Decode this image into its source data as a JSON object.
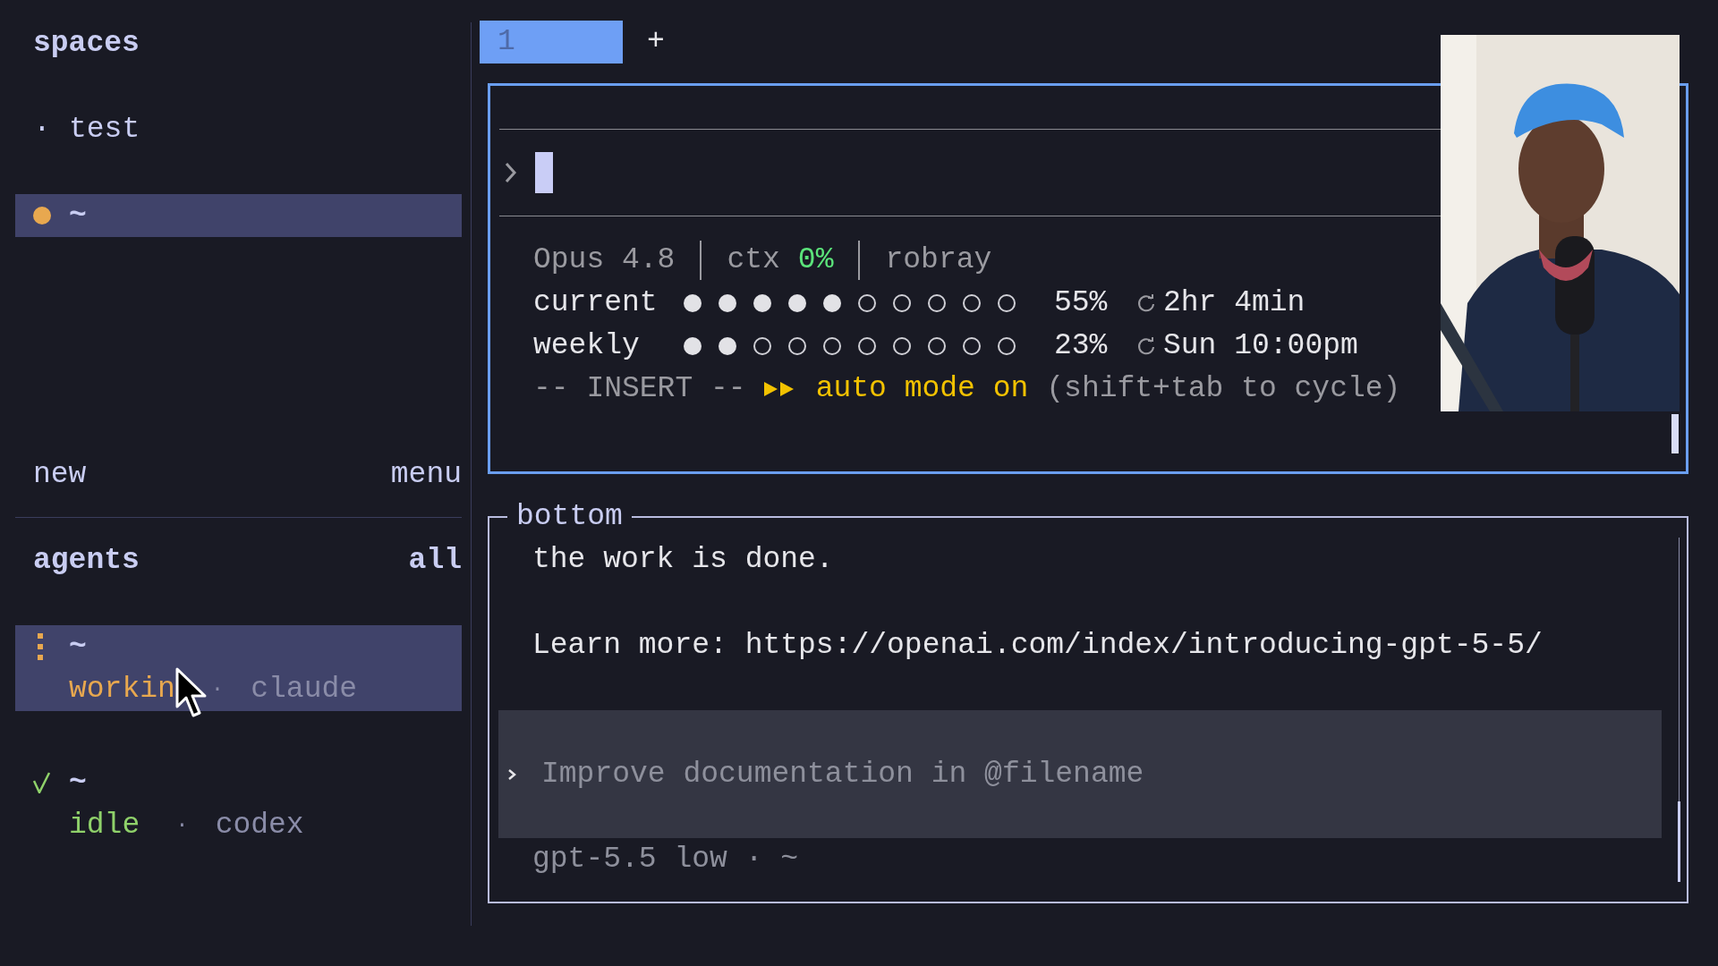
{
  "sidebar": {
    "spaces_title": "spaces",
    "spaces": [
      {
        "marker": "·",
        "name": "test",
        "selected": false
      },
      {
        "color": "#e8a84f",
        "name": "~",
        "selected": true
      }
    ],
    "actions": [
      "new",
      "menu"
    ],
    "agents_title": "agents",
    "agents_filter": "all",
    "agents": [
      {
        "kind": "working",
        "path": "~",
        "status": "workin",
        "separator": "·",
        "agent": "claude",
        "selected": true
      },
      {
        "kind": "idle",
        "path": "~",
        "status": "idle",
        "separator": "·",
        "agent": "codex",
        "selected": false
      }
    ]
  },
  "tabs": [
    {
      "label": "1",
      "selected": true
    }
  ],
  "new_tab": "+",
  "top_pane": {
    "model": "Opus 4.8",
    "ctx_label": "ctx",
    "ctx_value": "0%",
    "user": "robray",
    "meters": [
      {
        "label": "current",
        "level": 0.5,
        "percent": "55%",
        "reset": "2hr 4min"
      },
      {
        "label": "weekly",
        "level": 0.2,
        "percent": "23%",
        "reset": "Sun 10:00pm"
      }
    ],
    "mode": "-- INSERT --",
    "auto_mode": "auto mode on",
    "hint": "(shift+tab to cycle)"
  },
  "bottom_pane": {
    "title": "bottom",
    "lines": [
      "the work is done.",
      "Learn more: https://openai.com/index/introducing-gpt-5-5/"
    ],
    "placeholder": "Improve documentation in @filename",
    "footer": "gpt-5.5 low · ~"
  }
}
